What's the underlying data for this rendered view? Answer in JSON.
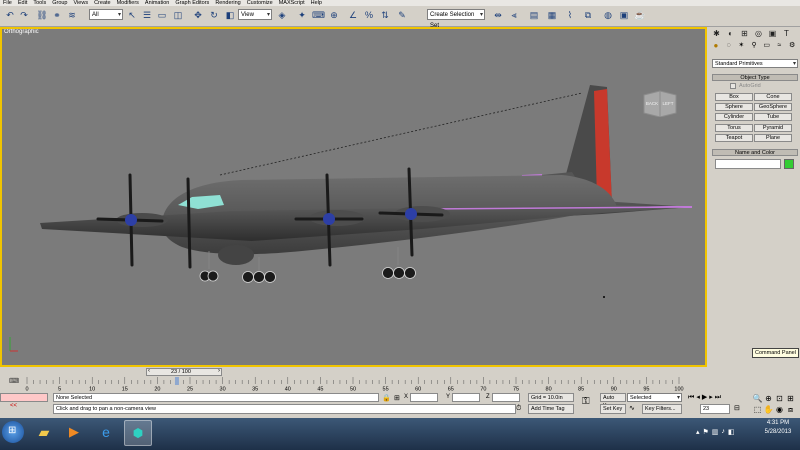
{
  "menu": [
    "File",
    "Edit",
    "Tools",
    "Group",
    "Views",
    "Create",
    "Modifiers",
    "Animation",
    "Graph Editors",
    "Rendering",
    "Customize",
    "MAXScript",
    "Help"
  ],
  "toolbar": {
    "selection_filter": "All",
    "reference_coord": "View",
    "named_selection": "Create Selection Set"
  },
  "viewport": {
    "label": "Orthographic",
    "viewcube_left": "BACK",
    "viewcube_right": "LEFT"
  },
  "command_panel": {
    "category_dropdown": "Standard Primitives",
    "object_type_header": "Object Type",
    "autogrid_label": "AutoGrid",
    "primitives": [
      "Box",
      "Cone",
      "Sphere",
      "GeoSphere",
      "Cylinder",
      "Tube",
      "Torus",
      "Pyramid",
      "Teapot",
      "Plane"
    ],
    "name_color_header": "Name and Color",
    "name_value": "",
    "object_color": "#33cc33",
    "tooltip": "Command Panel"
  },
  "timeline": {
    "frame_counter": "23 / 100",
    "ticks": [
      "0",
      "5",
      "10",
      "15",
      "20",
      "25",
      "30",
      "35",
      "40",
      "45",
      "50",
      "55",
      "60",
      "65",
      "70",
      "75",
      "80",
      "85",
      "90",
      "95",
      "100"
    ],
    "current_frame_fraction": 0.23
  },
  "status": {
    "selection": "None Selected",
    "prompt": "Click and drag to pan a non-camera view",
    "x_label": "X",
    "y_label": "Y",
    "z_label": "Z",
    "x_value": "",
    "y_value": "",
    "z_value": "",
    "grid": "Grid = 10.0in",
    "add_time_tag": "Add Time Tag",
    "auto_key": "Auto Key",
    "set_key": "Set Key",
    "key_mode": "Selected",
    "key_filters": "Key Filters...",
    "frame_field": "23",
    "maxscript_label": "<<"
  },
  "taskbar": {
    "time": "4:31 PM",
    "date": "5/28/2013"
  }
}
